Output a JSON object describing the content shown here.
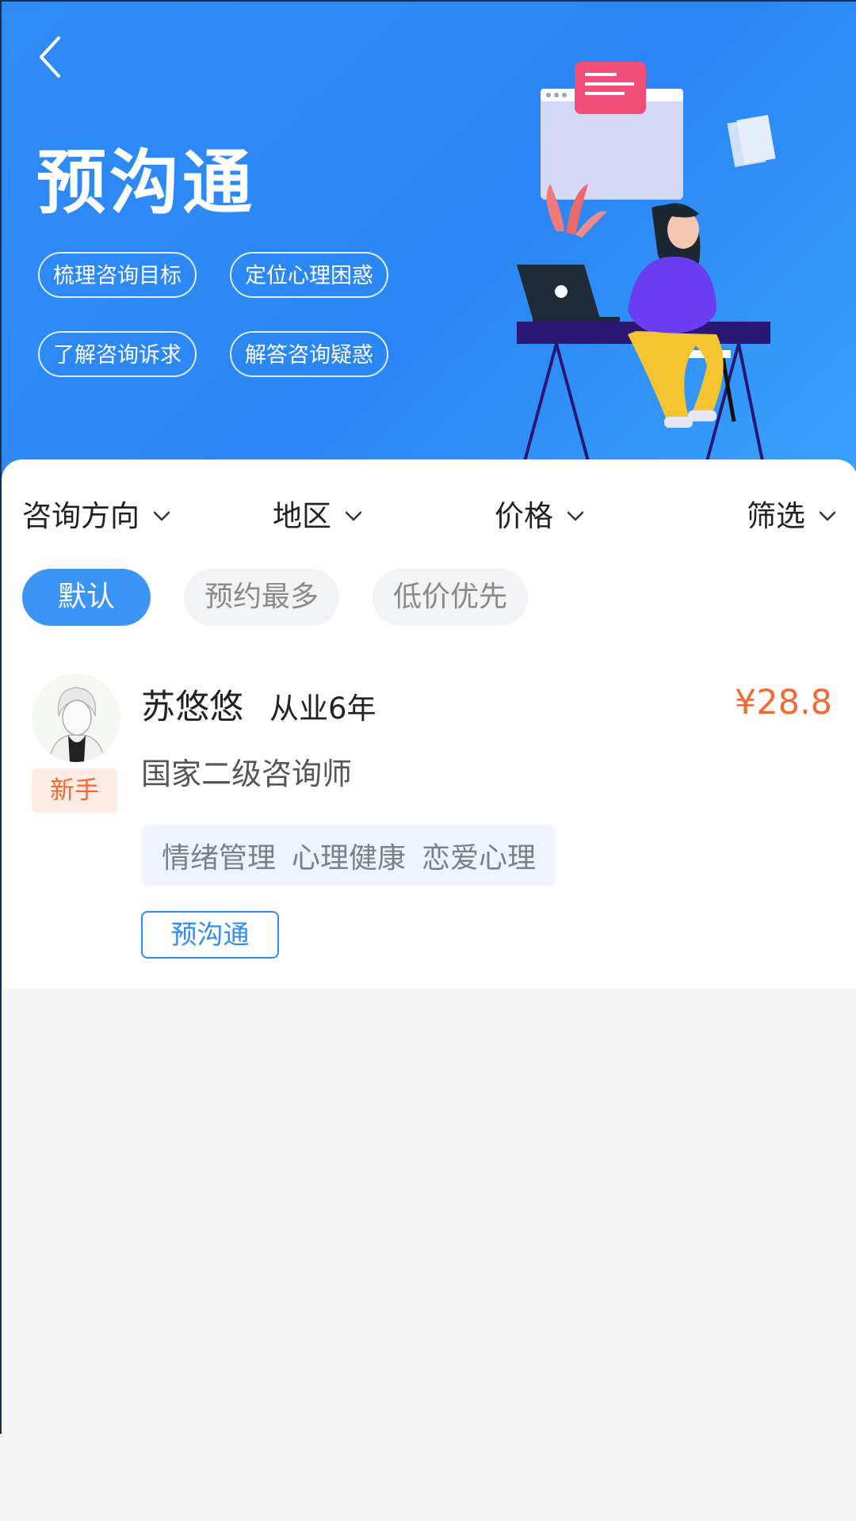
{
  "header": {
    "title": "预沟通",
    "chips": [
      "梳理咨询目标",
      "定位心理困惑",
      "了解咨询诉求",
      "解答咨询疑惑"
    ]
  },
  "filters": [
    {
      "label": "咨询方向"
    },
    {
      "label": "地区"
    },
    {
      "label": "价格"
    },
    {
      "label": "筛选"
    }
  ],
  "sort": [
    "默认",
    "预约最多",
    "低价优先"
  ],
  "counselor": {
    "name": "苏悠悠",
    "experience": "从业6年",
    "price": "¥28.8",
    "title": "国家二级咨询师",
    "badge": "新手",
    "tags": [
      "情绪管理",
      "心理健康",
      "恋爱心理"
    ],
    "action": "预沟通"
  },
  "colors": {
    "primary": "#2f8cf6",
    "price": "#f26a33",
    "badge_bg": "#fdebe4"
  }
}
